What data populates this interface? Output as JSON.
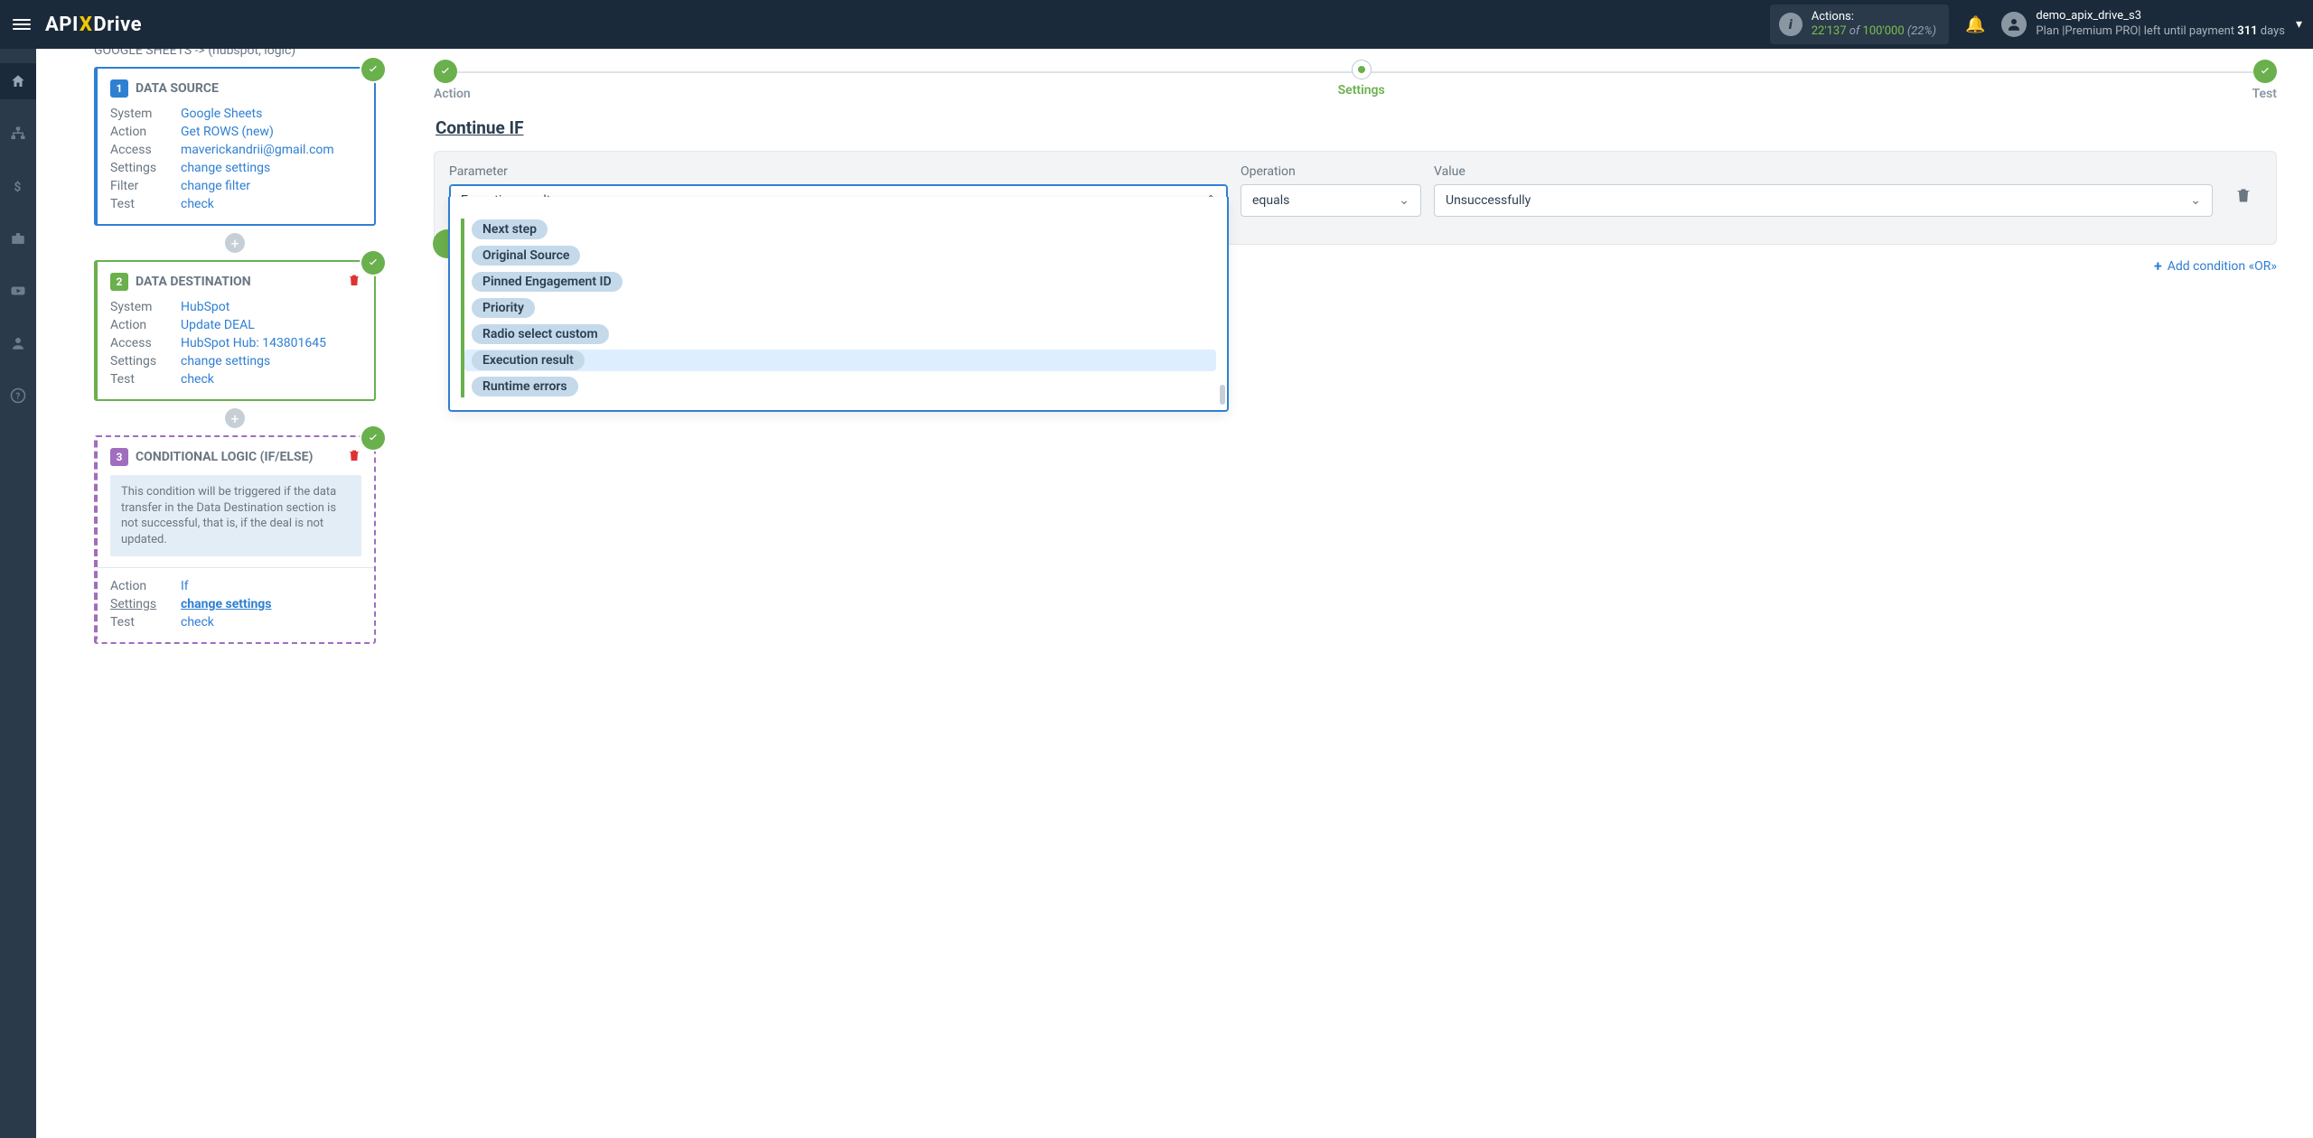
{
  "topbar": {
    "actions_label": "Actions:",
    "actions_used": "22'137",
    "actions_of": " of ",
    "actions_total": "100'000",
    "actions_pct": "(22%)",
    "user_name": "demo_apix_drive_s3",
    "plan_prefix": "Plan |Premium PRO| left until payment ",
    "plan_days": "311",
    "plan_suffix": " days"
  },
  "leftpanel": {
    "breadcrumb": "GOOGLE SHEETS -> (hubspot, logic)",
    "source": {
      "title": "DATA SOURCE",
      "num": "1",
      "rows": {
        "system_k": "System",
        "system_v": "Google Sheets",
        "action_k": "Action",
        "action_v": "Get ROWS (new)",
        "access_k": "Access",
        "access_v": "maverickandrii@gmail.com",
        "settings_k": "Settings",
        "settings_v": "change settings",
        "filter_k": "Filter",
        "filter_v": "change filter",
        "test_k": "Test",
        "test_v": "check"
      }
    },
    "dest": {
      "title": "DATA DESTINATION",
      "num": "2",
      "rows": {
        "system_k": "System",
        "system_v": "HubSpot",
        "action_k": "Action",
        "action_v": "Update DEAL",
        "access_k": "Access",
        "access_v": "HubSpot Hub: 143801645",
        "settings_k": "Settings",
        "settings_v": "change settings",
        "test_k": "Test",
        "test_v": "check"
      }
    },
    "logic": {
      "title": "CONDITIONAL LOGIC (IF/ELSE)",
      "num": "3",
      "note": "This condition will be triggered if the data transfer in the Data Destination section is not successful, that is, if the deal is not updated.",
      "rows": {
        "action_k": "Action",
        "action_v": "If",
        "settings_k": "Settings",
        "settings_v": "change settings",
        "test_k": "Test",
        "test_v": "check"
      }
    }
  },
  "steps": {
    "action": "Action",
    "settings": "Settings",
    "test": "Test"
  },
  "main": {
    "title": "Continue IF",
    "labels": {
      "parameter": "Parameter",
      "operation": "Operation",
      "value": "Value"
    },
    "parameter_value": "Execution result",
    "operation_value": "equals",
    "value_value": "Unsuccessfully",
    "options": {
      "o0": "Next step",
      "o1": "Original Source",
      "o2": "Pinned Engagement ID",
      "o3": "Priority",
      "o4": "Radio select custom",
      "o5": "Execution result",
      "o6": "Runtime errors"
    },
    "add_or": "Add condition «OR»"
  }
}
